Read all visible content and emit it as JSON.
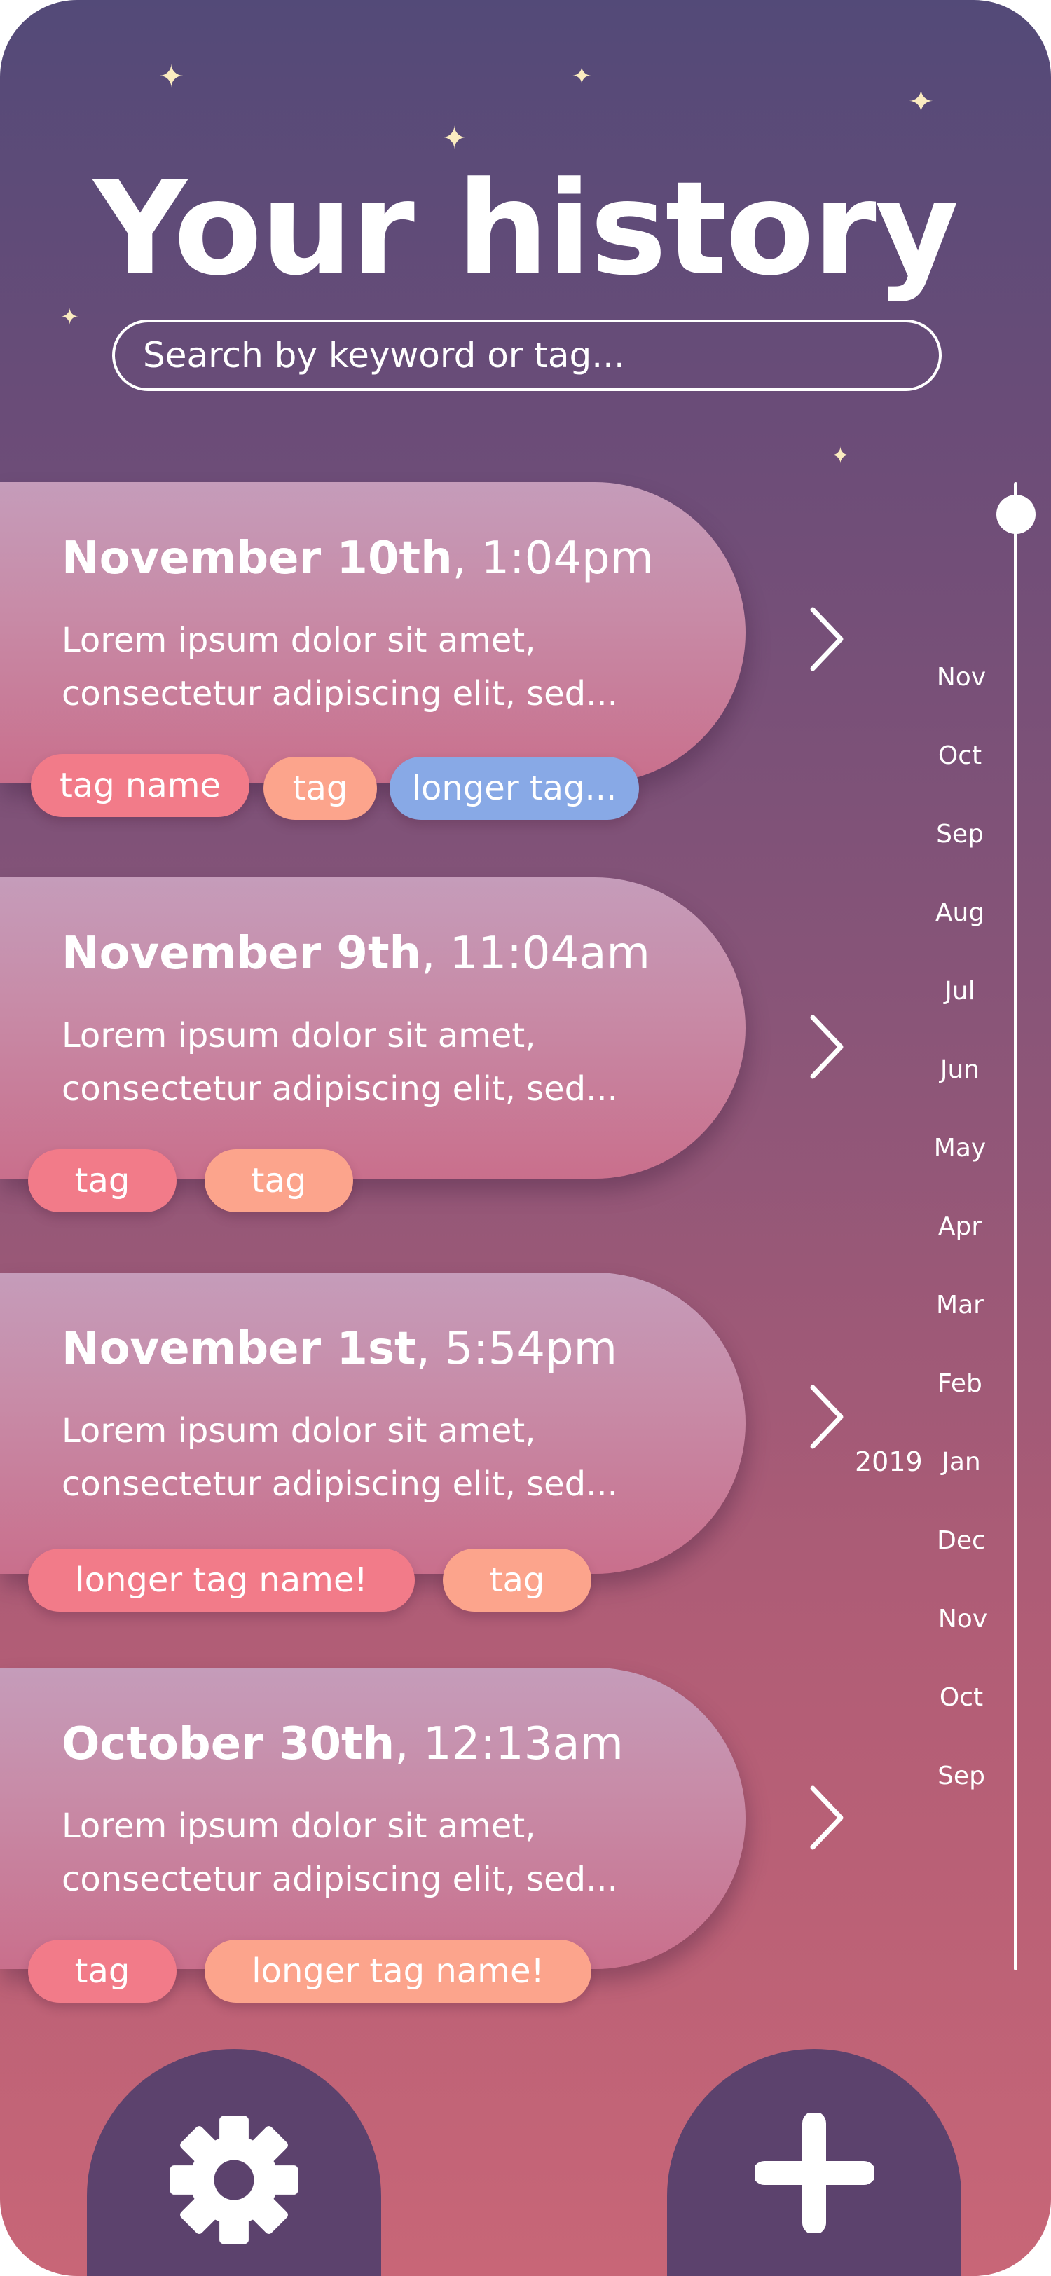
{
  "header": {
    "title": "Your history",
    "search_placeholder": "Search by keyword or tag..."
  },
  "entries": [
    {
      "date_bold": "November 10th",
      "date_rest": ", 1:04pm",
      "preview_line1": "Lorem ipsum dolor sit amet,",
      "preview_line2": "consectetur adipiscing elit, sed...",
      "tags": [
        "tag name",
        "tag",
        "longer tag..."
      ]
    },
    {
      "date_bold": "November 9th",
      "date_rest": ", 11:04am",
      "preview_line1": "Lorem ipsum dolor sit amet,",
      "preview_line2": "consectetur adipiscing elit, sed...",
      "tags": [
        "tag",
        "tag"
      ]
    },
    {
      "date_bold": "November 1st",
      "date_rest": ", 5:54pm",
      "preview_line1": "Lorem ipsum dolor sit amet,",
      "preview_line2": "consectetur adipiscing elit, sed...",
      "tags": [
        "longer tag name!",
        "tag"
      ]
    },
    {
      "date_bold": "October 30th",
      "date_rest": ", 12:13am",
      "preview_line1": "Lorem ipsum dolor sit amet,",
      "preview_line2": "consectetur adipiscing elit, sed...",
      "tags": [
        "tag",
        "longer tag name!"
      ]
    }
  ],
  "timeline": {
    "year_marker": "2019",
    "months": [
      "Nov",
      "Oct",
      "Sep",
      "Aug",
      "Jul",
      "Jun",
      "May",
      "Apr",
      "Mar",
      "Feb",
      "Jan",
      "Dec",
      "Nov",
      "Oct",
      "Sep"
    ]
  },
  "icons": {
    "chevron": "chevron-right-icon",
    "settings": "gear-icon",
    "add": "plus-icon",
    "star": "sparkle-star-icon"
  },
  "colors": {
    "background_top": "#534a78",
    "background_bottom": "#c86677",
    "tag_red": "#f27b89",
    "tag_peach": "#fca48c",
    "tag_blue": "#88a9e6",
    "fab": "#5c426d",
    "star": "#fbecc0"
  }
}
